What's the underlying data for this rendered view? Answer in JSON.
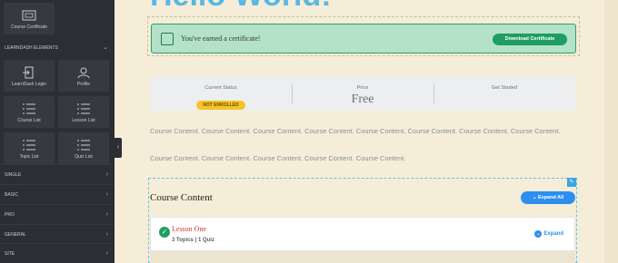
{
  "sidebar": {
    "top_tile": {
      "label": "Course Certificate",
      "icon": "certificate-icon"
    },
    "section_header": "LEARNDASH ELEMENTS",
    "widgets": [
      {
        "label": "LearnDash Login",
        "icon": "login-icon"
      },
      {
        "label": "Profile",
        "icon": "profile-icon"
      },
      {
        "label": "Course List",
        "icon": "list-icon"
      },
      {
        "label": "Lesson List",
        "icon": "list-icon"
      },
      {
        "label": "Topic List",
        "icon": "list-icon"
      },
      {
        "label": "Quiz List",
        "icon": "list-icon"
      }
    ],
    "categories": [
      "SINGLE",
      "BASIC",
      "PRO",
      "GENERAL",
      "SITE"
    ]
  },
  "page": {
    "hello_heading": "Hello World!",
    "certificate": {
      "message": "You've earned a certificate!",
      "button_label": "Download Certificate"
    },
    "status_bar": {
      "current_status_label": "Current Status",
      "current_status_value": "NOT ENROLLED",
      "price_label": "Price",
      "price_value": "Free",
      "get_started_label": "Get Started"
    },
    "paragraph_1": "Course Content. Course Content. Course Content. Course Content. Course Content. Course Content. Course Content. Course Content.",
    "paragraph_2": "Course Content. Course Content. Course Content. Course Content. Course Content.",
    "course_content": {
      "heading": "Course Content",
      "expand_all_label": "Expand All",
      "lessons": [
        {
          "title": "Lesson One",
          "topics": "3 Topics",
          "quizzes": "1 Quiz",
          "expand_label": "Expand"
        }
      ]
    }
  },
  "colors": {
    "accent": "#2d8ff0",
    "success": "#1f9d63",
    "badge": "#f5c42a",
    "lesson_title": "#d2332b",
    "heading": "#58b8e4"
  }
}
